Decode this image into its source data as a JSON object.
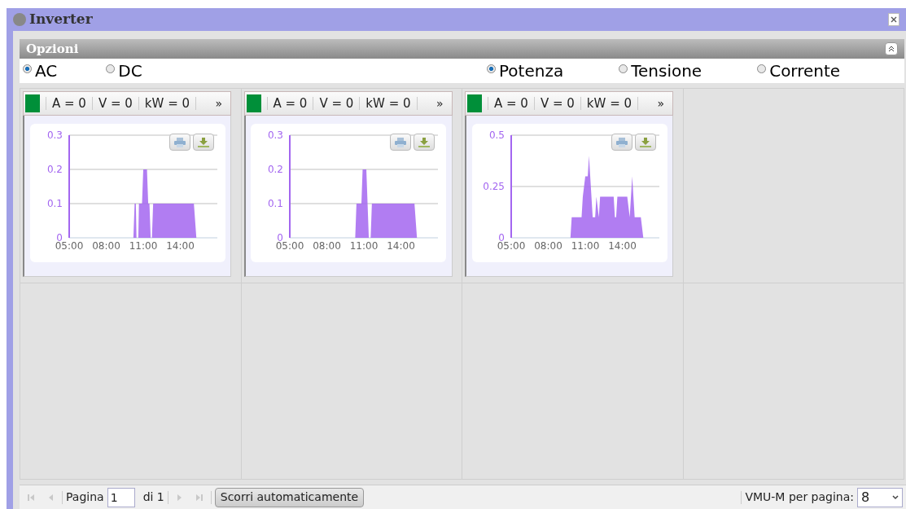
{
  "window": {
    "title": "Inverter"
  },
  "options_panel": {
    "title": "Opzioni"
  },
  "mode_options": [
    {
      "label": "AC",
      "selected": true
    },
    {
      "label": "DC",
      "selected": false
    }
  ],
  "measure_options": [
    {
      "label": "Potenza",
      "selected": true
    },
    {
      "label": "Tensione",
      "selected": false
    },
    {
      "label": "Corrente",
      "selected": false
    }
  ],
  "panels": [
    {
      "color": "#008f39",
      "readouts": [
        "A = 0",
        "V = 0",
        "kW = 0"
      ],
      "expand": "»",
      "chart_data": {
        "type": "area",
        "x": [
          7,
          10.2,
          10.3,
          10.4,
          10.45,
          10.6,
          10.65,
          10.9,
          11,
          11.3,
          11.4,
          11.5,
          11.6,
          11.7,
          11.8,
          15.1,
          15.3,
          16.8
        ],
        "series": [
          {
            "color": "#a366f0",
            "values": [
              0,
              0,
              0.1,
              0.1,
              0,
              0,
              0.1,
              0.1,
              0.2,
              0.2,
              0.1,
              0.1,
              0,
              0,
              0.1,
              0.1,
              0,
              0
            ]
          }
        ],
        "xlim": [
          5,
          17
        ],
        "ylim": [
          0,
          0.3
        ],
        "xticks": [
          {
            "value": 5,
            "label": "05:00"
          },
          {
            "value": 8,
            "label": "08:00"
          },
          {
            "value": 11,
            "label": "11:00"
          },
          {
            "value": 14,
            "label": "14:00"
          }
        ],
        "yticks": [
          0,
          0.1,
          0.2,
          0.3
        ]
      }
    },
    {
      "color": "#008f39",
      "readouts": [
        "A = 0",
        "V = 0",
        "kW = 0"
      ],
      "expand": "»",
      "chart_data": {
        "type": "area",
        "x": [
          7,
          10.3,
          10.4,
          10.8,
          10.9,
          11.2,
          11.3,
          11.4,
          11.55,
          11.65,
          15.1,
          15.3,
          16.8
        ],
        "series": [
          {
            "color": "#a366f0",
            "values": [
              0,
              0,
              0.1,
              0.1,
              0.2,
              0.2,
              0.1,
              0,
              0,
              0.1,
              0.1,
              0,
              0
            ]
          }
        ],
        "xlim": [
          5,
          17
        ],
        "ylim": [
          0,
          0.3
        ],
        "xticks": [
          {
            "value": 5,
            "label": "05:00"
          },
          {
            "value": 8,
            "label": "08:00"
          },
          {
            "value": 11,
            "label": "11:00"
          },
          {
            "value": 14,
            "label": "14:00"
          }
        ],
        "yticks": [
          0,
          0.1,
          0.2,
          0.3
        ]
      }
    },
    {
      "color": "#008f39",
      "readouts": [
        "A = 0",
        "V = 0",
        "kW = 0"
      ],
      "expand": "»",
      "chart_data": {
        "type": "area",
        "x": [
          7,
          9.8,
          9.9,
          10.7,
          10.8,
          11,
          11.2,
          11.3,
          11.6,
          11.8,
          11.9,
          12.1,
          12.2,
          13.3,
          13.4,
          13.5,
          13.6,
          14.4,
          14.6,
          14.8,
          15,
          15.5,
          15.7,
          16.8
        ],
        "series": [
          {
            "color": "#a366f0",
            "values": [
              0,
              0,
              0.1,
              0.1,
              0.2,
              0.3,
              0.3,
              0.4,
              0.1,
              0.1,
              0.2,
              0.1,
              0.2,
              0.2,
              0.1,
              0.1,
              0.2,
              0.2,
              0.1,
              0.3,
              0.1,
              0.1,
              0,
              0
            ]
          }
        ],
        "xlim": [
          5,
          17
        ],
        "ylim": [
          0,
          0.5
        ],
        "xticks": [
          {
            "value": 5,
            "label": "05:00"
          },
          {
            "value": 8,
            "label": "08:00"
          },
          {
            "value": 11,
            "label": "11:00"
          },
          {
            "value": 14,
            "label": "14:00"
          }
        ],
        "yticks": [
          0,
          0.25,
          0.5
        ]
      }
    }
  ],
  "pager": {
    "page_label": "Pagina",
    "page_value": "1",
    "page_total": "di 1",
    "autoscroll": "Scorri automaticamente",
    "per_page_label": "VMU-M per pagina:",
    "per_page_value": "8"
  }
}
